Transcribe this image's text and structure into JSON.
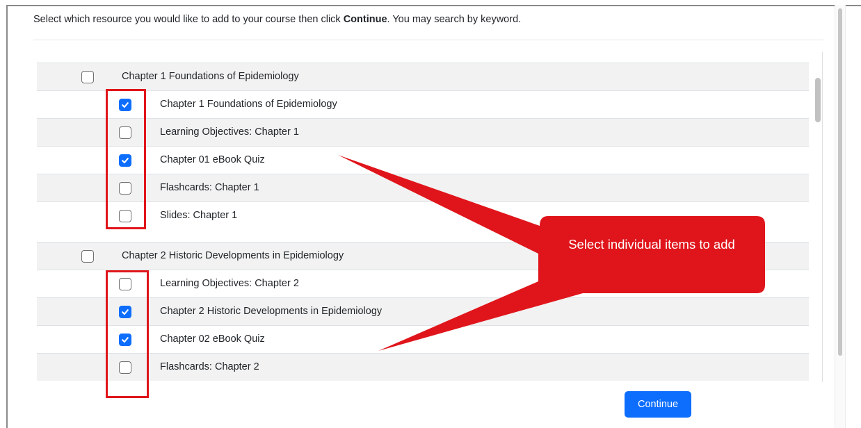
{
  "instructions": {
    "before": "Select which resource you would like to add to your course then click ",
    "bold": "Continue",
    "after": ". You may search by keyword."
  },
  "rows": [
    {
      "type": "group",
      "label": "Chapter 1 Foundations of Epidemiology",
      "checked": false
    },
    {
      "type": "item",
      "label": "Chapter 1 Foundations of Epidemiology",
      "checked": true
    },
    {
      "type": "item",
      "label": "Learning Objectives: Chapter 1",
      "checked": false
    },
    {
      "type": "item",
      "label": "Chapter 01 eBook Quiz",
      "checked": true
    },
    {
      "type": "item",
      "label": "Flashcards: Chapter 1",
      "checked": false
    },
    {
      "type": "item",
      "label": "Slides: Chapter 1",
      "checked": false
    },
    {
      "type": "group",
      "label": "Chapter 2 Historic Developments in Epidemiology",
      "checked": false
    },
    {
      "type": "item",
      "label": "Learning Objectives: Chapter 2",
      "checked": false
    },
    {
      "type": "item",
      "label": "Chapter 2 Historic Developments in Epidemiology",
      "checked": true
    },
    {
      "type": "item",
      "label": "Chapter 02 eBook Quiz",
      "checked": true
    },
    {
      "type": "item",
      "label": "Flashcards: Chapter 2",
      "checked": false
    }
  ],
  "continue_label": "Continue",
  "annotation": {
    "text": "Select individual items to add",
    "color": "#e0151b"
  },
  "colors": {
    "accent": "#0d6efd",
    "annotation": "#e0151b"
  }
}
